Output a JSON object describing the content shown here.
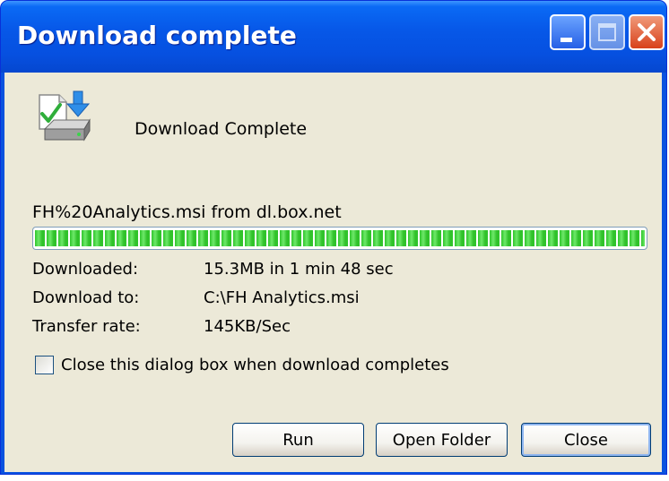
{
  "window": {
    "title": "Download complete",
    "controls": [
      "minimize",
      "maximize",
      "close"
    ]
  },
  "header": {
    "icon": "download-complete-icon",
    "text": "Download Complete"
  },
  "download": {
    "source_line": "FH%20Analytics.msi from dl.box.net",
    "progress_fraction": 1.0
  },
  "details": {
    "downloaded_label": "Downloaded:",
    "downloaded_value": "15.3MB in 1 min 48 sec",
    "download_to_label": "Download to:",
    "download_to_value": "C:\\FH Analytics.msi",
    "transfer_rate_label": "Transfer rate:",
    "transfer_rate_value": "145KB/Sec"
  },
  "options": {
    "close_when_complete_label": "Close this dialog box when download completes",
    "close_when_complete_checked": false
  },
  "buttons": {
    "run": "Run",
    "open_folder": "Open Folder",
    "close": "Close"
  },
  "colors": {
    "title_bar": "#0a5ee8",
    "dialog_bg": "#ece9d8",
    "progress_green": "#2fc52b",
    "close_button_red": "#d8411a"
  }
}
